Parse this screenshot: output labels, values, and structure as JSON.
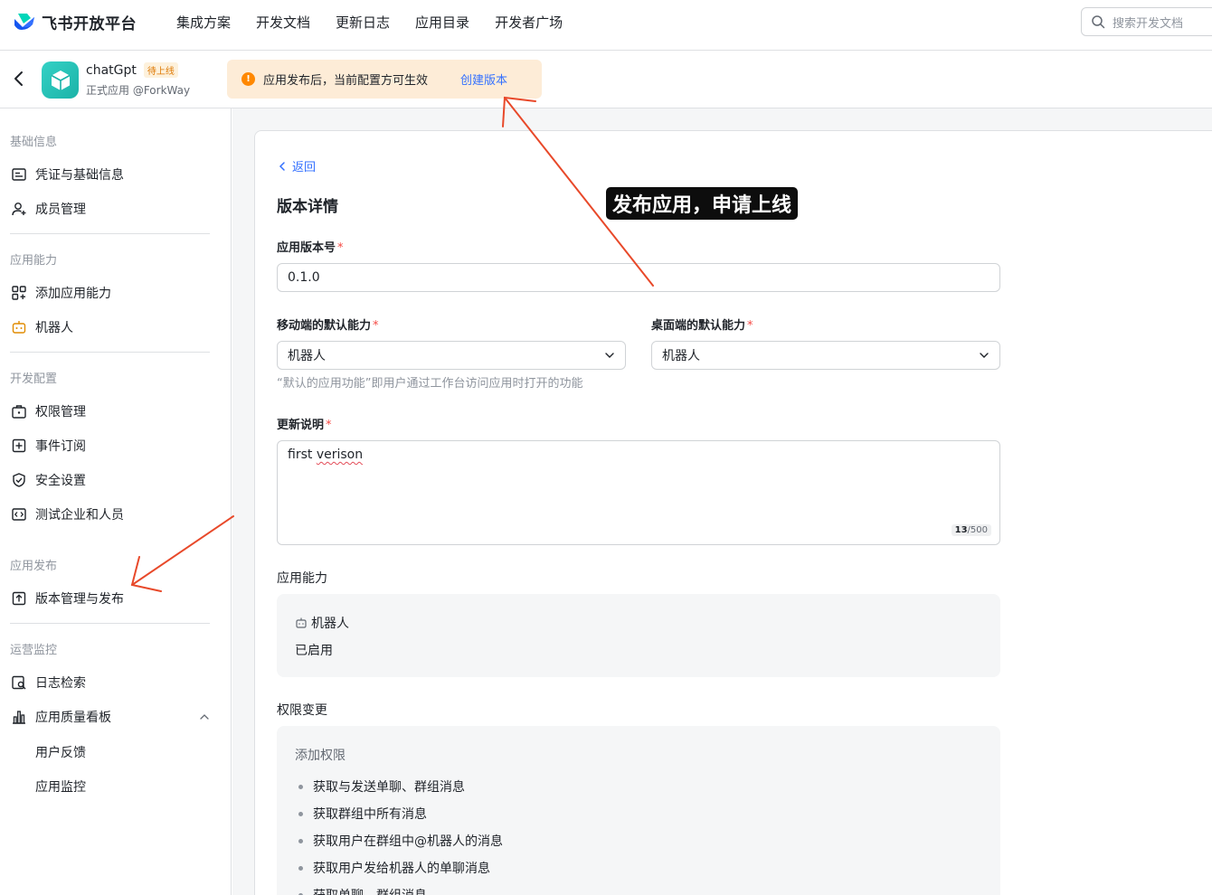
{
  "brand": {
    "name": "飞书开放平台"
  },
  "topnav": {
    "links": [
      "集成方案",
      "开发文档",
      "更新日志",
      "应用目录",
      "开发者广场"
    ],
    "search_placeholder": "搜索开发文档"
  },
  "app": {
    "name": "chatGpt",
    "badge": "待上线",
    "subtitle": "正式应用 @ForkWay",
    "notice": {
      "message": "应用发布后，当前配置方可生效",
      "action": "创建版本"
    }
  },
  "sidebar": {
    "sections": {
      "basic": "基础信息",
      "capability": "应用能力",
      "dev": "开发配置",
      "publish": "应用发布",
      "ops": "运营监控"
    },
    "items": {
      "credentials": "凭证与基础信息",
      "members": "成员管理",
      "add_capability": "添加应用能力",
      "bot": "机器人",
      "permissions": "权限管理",
      "events": "事件订阅",
      "security": "安全设置",
      "test_org": "测试企业和人员",
      "version_mgmt": "版本管理与发布",
      "log_search": "日志检索",
      "quality_board": "应用质量看板",
      "user_feedback": "用户反馈",
      "app_monitor": "应用监控"
    }
  },
  "form": {
    "back_label": "返回",
    "page_title": "版本详情",
    "version_label": "应用版本号",
    "version_value": "0.1.0",
    "mobile_label": "移动端的默认能力",
    "mobile_value": "机器人",
    "desktop_label": "桌面端的默认能力",
    "desktop_value": "机器人",
    "hint": "“默认的应用功能”即用户通过工作台访问应用时打开的功能",
    "update_label": "更新说明",
    "update_word1": "first",
    "update_word2": "verison",
    "counter_current": "13",
    "counter_max": "/500",
    "required_mark": "*"
  },
  "capabilities": {
    "title": "应用能力",
    "name": "机器人",
    "status": "已启用"
  },
  "permissions": {
    "title": "权限变更",
    "group": "添加权限",
    "items": [
      "获取与发送单聊、群组消息",
      "获取群组中所有消息",
      "获取用户在群组中@机器人的消息",
      "获取用户发给机器人的单聊消息",
      "获取单聊、群组消息"
    ]
  },
  "annotation": {
    "callout": "发布应用，申请上线",
    "color": "#e8492a"
  }
}
